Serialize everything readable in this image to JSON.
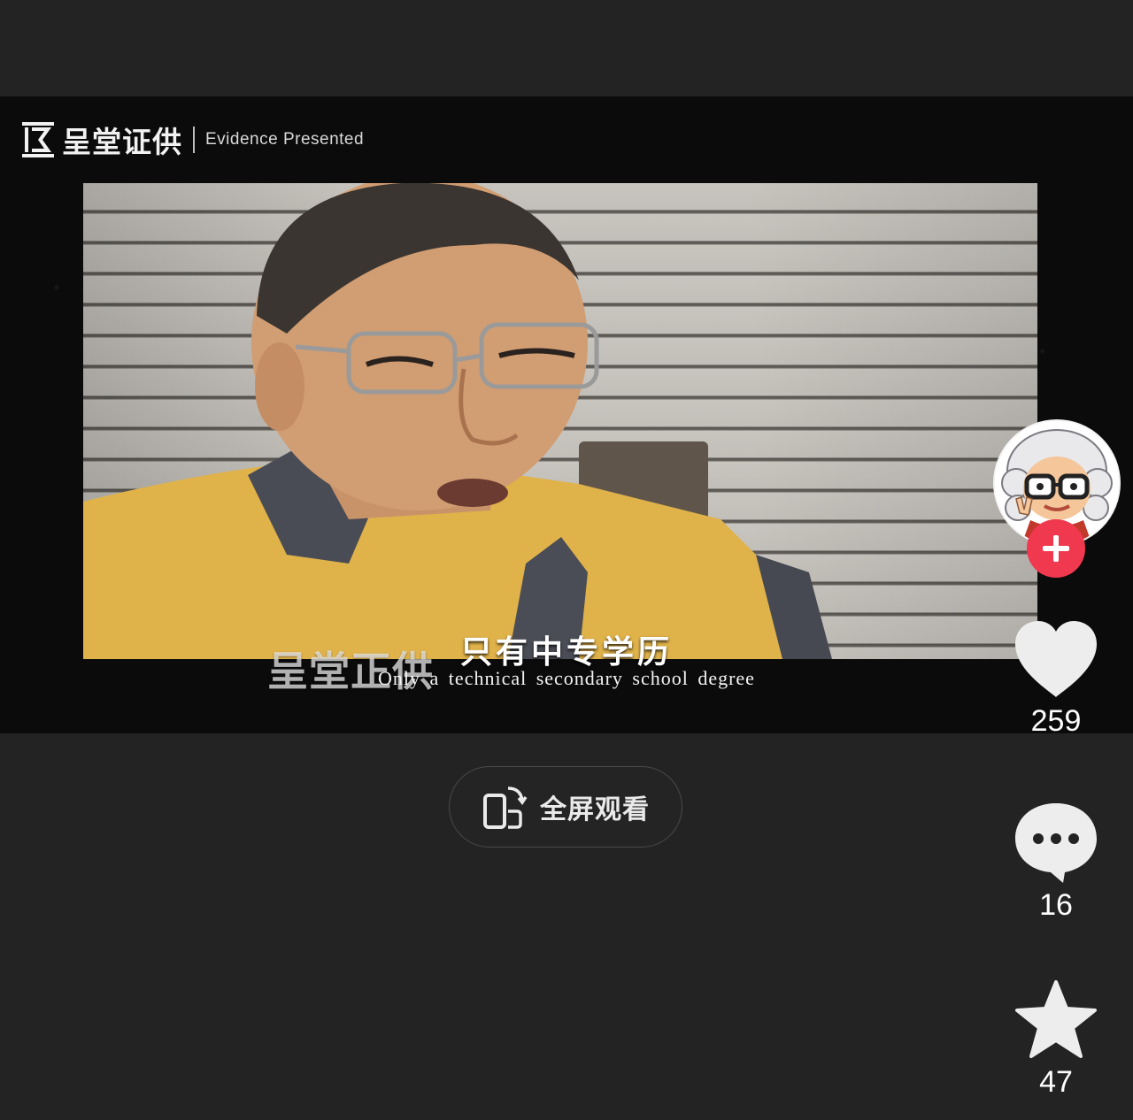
{
  "video": {
    "brand_cn": "呈堂证供",
    "brand_en": "Evidence Presented",
    "watermark": "呈堂正供",
    "subtitle_cn": "只有中专学历",
    "subtitle_en": "Only a technical secondary school degree"
  },
  "fullscreen_button": {
    "label": "全屏观看",
    "icon": "rotate-phone-icon"
  },
  "actions": {
    "avatar_icon": "creator-avatar",
    "follow_icon": "plus-icon",
    "like": {
      "count": "259",
      "icon": "heart-icon"
    },
    "comment": {
      "count": "16",
      "icon": "comment-bubble-icon"
    },
    "favorite": {
      "count": "47",
      "icon": "star-icon"
    }
  },
  "colors": {
    "background": "#232323",
    "follow_red": "#f0384f",
    "text": "#ffffff"
  }
}
